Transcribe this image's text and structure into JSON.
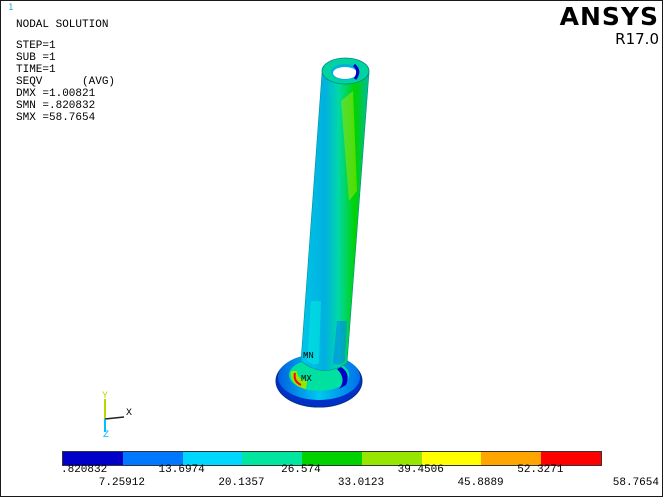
{
  "window": {
    "number": "1"
  },
  "info": {
    "title": "NODAL SOLUTION",
    "lines": [
      "STEP=1",
      "SUB =1",
      "TIME=1",
      "SEQV      (AVG)",
      "DMX =1.00821",
      "SMN =.820832",
      "SMX =58.7654"
    ]
  },
  "brand": {
    "name": "ANSYS",
    "version": "R17.0"
  },
  "markers": {
    "min": "MN",
    "max": "MX"
  },
  "triad": {
    "x": "X",
    "y": "Y",
    "z": "Z"
  },
  "legend": {
    "colors": [
      "#0000c8",
      "#0077ff",
      "#00d7ff",
      "#00e6a0",
      "#00d200",
      "#96e600",
      "#ffff00",
      "#ffa500",
      "#ff0000"
    ],
    "labels": [
      ".820832",
      "7.25912",
      "13.6974",
      "20.1357",
      "26.574",
      "33.0123",
      "39.4506",
      "45.8889",
      "52.3271",
      "58.7654"
    ]
  }
}
